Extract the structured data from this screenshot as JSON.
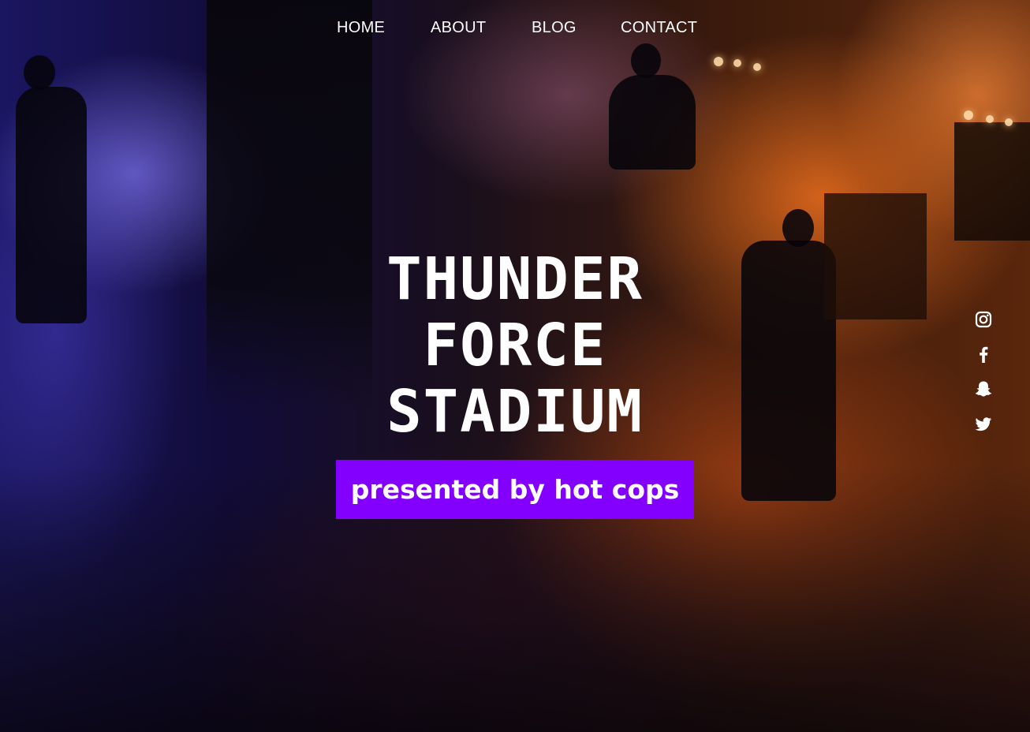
{
  "nav": {
    "items": [
      {
        "label": "HOME"
      },
      {
        "label": "ABOUT"
      },
      {
        "label": "BLOG"
      },
      {
        "label": "CONTACT"
      }
    ]
  },
  "hero": {
    "title_lines": [
      "THUNDER",
      "FORCE",
      "STADIUM"
    ],
    "cta_label": "presented by hot cops"
  },
  "social": {
    "icons": [
      "instagram-icon",
      "facebook-icon",
      "snapchat-icon",
      "twitter-icon"
    ]
  },
  "colors": {
    "accent": "#8300ff",
    "text": "#ffffff"
  }
}
